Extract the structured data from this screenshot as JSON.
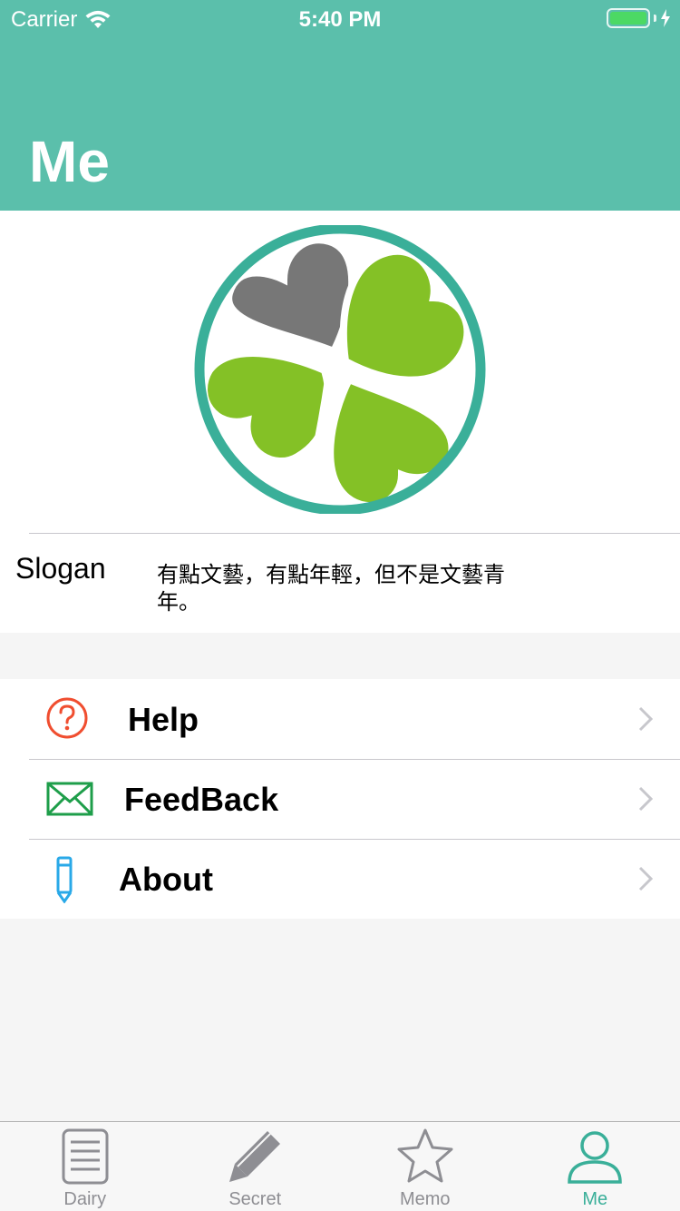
{
  "status_bar": {
    "carrier": "Carrier",
    "time": "5:40 PM",
    "battery_level": 1.0
  },
  "header": {
    "title": "Me",
    "background_color": "#5bbfab"
  },
  "profile": {
    "avatar_icon": "clover-logo",
    "slogan_label": "Slogan",
    "slogan_text": "有點文藝，有點年輕，但不是文藝青年。"
  },
  "menu": {
    "items": [
      {
        "label": "Help",
        "icon": "question-circle-icon",
        "icon_color": "#f04e30"
      },
      {
        "label": "FeedBack",
        "icon": "envelope-icon",
        "icon_color": "#1e9e4a"
      },
      {
        "label": "About",
        "icon": "pencil-icon",
        "icon_color": "#29a9e8"
      }
    ]
  },
  "tab_bar": {
    "tabs": [
      {
        "label": "Dairy",
        "icon": "document-icon",
        "active": false
      },
      {
        "label": "Secret",
        "icon": "pencil-icon",
        "active": false
      },
      {
        "label": "Memo",
        "icon": "star-icon",
        "active": false
      },
      {
        "label": "Me",
        "icon": "person-icon",
        "active": true
      }
    ],
    "active_color": "#3aaf99",
    "inactive_color": "#8e8e93"
  }
}
